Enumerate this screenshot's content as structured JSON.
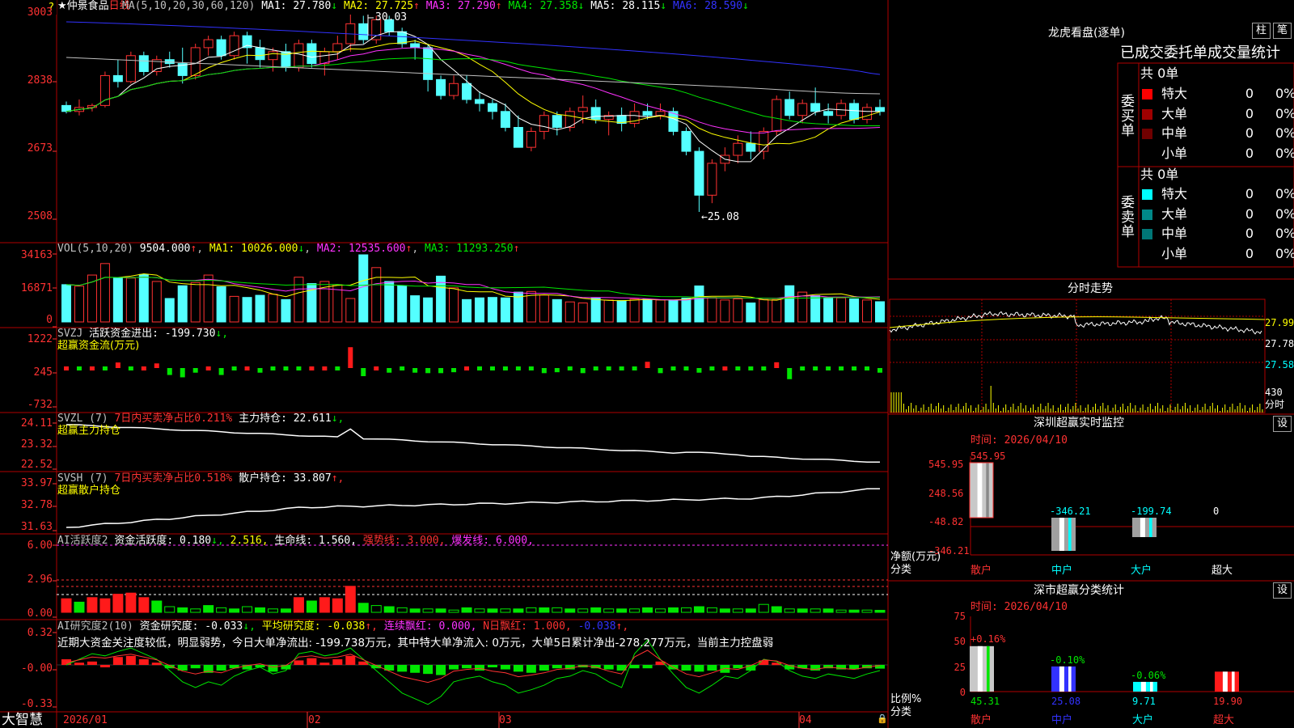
{
  "stock": {
    "star": "★",
    "name": "仲景食品",
    "period": "日线"
  },
  "main": {
    "ma_title": "MA(5,10,20,30,60,120)",
    "ma1": "MA1: 27.780",
    "ma2": "MA2: 27.725",
    "ma3": "MA3: 27.290",
    "ma4": "MA4: 27.358",
    "ma5": "MA5: 28.115",
    "ma6": "MA6: 28.590",
    "ma1_dir": "↓",
    "ma2_dir": "↑",
    "ma3_dir": "↑",
    "ma4_dir": "↓",
    "ma5_dir": "↓",
    "ma6_dir": "↓",
    "yticks": [
      "3003",
      "2838",
      "2673",
      "2508"
    ],
    "high_label": "30.03",
    "low_label": "←25.08"
  },
  "vol": {
    "title": "VOL(5,10,20)",
    "value": "9504.000",
    "value_dir": "↑",
    "ma1": "MA1: 10026.000",
    "ma1_dir": "↓",
    "ma2": "MA2: 12535.600",
    "ma2_dir": "↑",
    "ma3": "MA3: 11293.250",
    "ma3_dir": "↑",
    "yticks": [
      "34163",
      "16871",
      "0"
    ]
  },
  "svzj": {
    "title": "SVZJ",
    "label": "活跃资金进出: -199.730",
    "dir": "↓,",
    "sub": "超赢资金流(万元)",
    "yticks": [
      "1222",
      "245",
      "-732"
    ]
  },
  "svzl": {
    "title": "SVZL (7)",
    "label1": "7日内买卖净占比0.211%",
    "label2": "主力持仓: 22.611",
    "dir": "↓,",
    "sub": "超赢主力持仓",
    "yticks": [
      "24.11",
      "23.32",
      "22.52"
    ]
  },
  "svsh": {
    "title": "SVSH (7)",
    "label1": "7日内买卖净占比0.518%",
    "label2": "散户持仓: 33.807",
    "dir": "↑,",
    "sub": "超赢散户持仓",
    "yticks": [
      "33.97",
      "32.78",
      "31.63"
    ]
  },
  "ai1": {
    "title": "AI活跃度2",
    "label": "资金活跃度: 0.180",
    "dir": "↓,",
    "v2": "2.516,",
    "life": "生命线: 1.560,",
    "strong": "强势线: 3.000,",
    "burst": "爆发线: 6.000,",
    "yticks": [
      "6.00",
      "2.96",
      "0.00"
    ]
  },
  "ai2": {
    "title": "AI研究度2(10)",
    "label": "资金研究度: -0.033",
    "dir": "↓,",
    "avg": "平均研究度: -0.038",
    "avg_dir": "↑,",
    "cont": "连续飘红: 0.000,",
    "nday": "N日飘红: 1.000,",
    "neg": "-0.038",
    "neg_dir": "↑,",
    "comment": "近期大资金关注度较低，明显弱势，今日大单净流出: -199.738万元，其中特大单净流入: 0万元，大单5日累计净出-278.277万元，当前主力控盘弱",
    "yticks": [
      "0.32",
      "-0.00",
      "-0.33"
    ]
  },
  "xaxis": {
    "labels": [
      "2026/01",
      "02",
      "03",
      "04"
    ]
  },
  "footer": {
    "brand": "大智慧"
  },
  "right": {
    "lhb_title": "龙虎看盘(逐单)",
    "btn_zhu": "柱",
    "btn_bi": "笔",
    "stats_title": "已成交委托单成交量统计",
    "buy": {
      "side": "委买单",
      "total": "共 0单",
      "rows": [
        {
          "name": "特大",
          "count": "0",
          "pct": "0%"
        },
        {
          "name": "大单",
          "count": "0",
          "pct": "0%"
        },
        {
          "name": "中单",
          "count": "0",
          "pct": "0%"
        },
        {
          "name": "小单",
          "count": "0",
          "pct": "0%"
        }
      ]
    },
    "sell": {
      "side": "委卖单",
      "total": "共 0单",
      "rows": [
        {
          "name": "特大",
          "count": "0",
          "pct": "0%"
        },
        {
          "name": "大单",
          "count": "0",
          "pct": "0%"
        },
        {
          "name": "中单",
          "count": "0",
          "pct": "0%"
        },
        {
          "name": "小单",
          "count": "0",
          "pct": "0%"
        }
      ]
    },
    "fs_title": "分时走势",
    "fs_prices": [
      "27.99",
      "27.78",
      "27.58"
    ],
    "fs_vol": "430",
    "fs_unit": "分时",
    "monitor": {
      "title": "深圳超赢实时监控",
      "btn": "设",
      "time": "时间: 2026/04/10",
      "yticks": [
        "545.95",
        "248.56",
        "-48.82",
        "-346.21"
      ],
      "ylabel": "净额(万元)",
      "xlabel": "分类",
      "categories": [
        "散户",
        "中户",
        "大户",
        "超大"
      ],
      "values_text": [
        "545.95",
        "-346.21",
        "-199.74",
        "0"
      ]
    },
    "dist": {
      "title": "深市超赢分类统计",
      "btn": "设",
      "time": "时间: 2026/04/10",
      "yticks": [
        "75",
        "50",
        "25",
        "0"
      ],
      "ylabel": "比例%",
      "xlabel": "分类",
      "categories": [
        "散户",
        "中户",
        "大户",
        "超大"
      ],
      "pct_change": [
        "+0.16%",
        "-0.10%",
        "-0.06%",
        ""
      ],
      "values_text": [
        "45.31",
        "25.08",
        "9.71",
        "19.90"
      ]
    }
  },
  "chart_data": [
    {
      "type": "candlestick",
      "title": "仲景食品 日线",
      "ylim": [
        25.08,
        30.03
      ],
      "ma": {
        "MA1": 27.78,
        "MA2": 27.725,
        "MA3": 27.29,
        "MA4": 27.358,
        "MA5": 28.115,
        "MA6": 28.59
      },
      "ohlc": [
        [
          27.75,
          27.85,
          27.55,
          27.6
        ],
        [
          27.6,
          27.9,
          27.5,
          27.7
        ],
        [
          27.7,
          27.8,
          27.6,
          27.75
        ],
        [
          27.75,
          28.6,
          27.7,
          28.5
        ],
        [
          28.5,
          28.9,
          28.2,
          28.35
        ],
        [
          28.35,
          29.1,
          28.3,
          29.0
        ],
        [
          29.0,
          29.1,
          28.5,
          28.6
        ],
        [
          28.6,
          29.0,
          28.5,
          28.9
        ],
        [
          28.9,
          29.1,
          28.7,
          28.8
        ],
        [
          28.8,
          29.2,
          28.3,
          28.5
        ],
        [
          28.5,
          29.3,
          28.4,
          29.2
        ],
        [
          29.2,
          29.5,
          29.0,
          29.4
        ],
        [
          29.4,
          29.5,
          28.9,
          29.0
        ],
        [
          29.0,
          29.6,
          28.9,
          29.5
        ],
        [
          29.5,
          29.6,
          28.8,
          29.2
        ],
        [
          29.2,
          29.4,
          28.7,
          28.9
        ],
        [
          28.9,
          29.2,
          28.6,
          29.1
        ],
        [
          29.1,
          29.3,
          28.6,
          28.7
        ],
        [
          28.7,
          29.4,
          28.6,
          29.3
        ],
        [
          29.3,
          29.4,
          28.7,
          28.8
        ],
        [
          28.8,
          29.2,
          28.5,
          29.1
        ],
        [
          29.1,
          29.5,
          28.9,
          29.3
        ],
        [
          29.3,
          30.03,
          29.1,
          29.8
        ],
        [
          29.8,
          30.0,
          29.3,
          29.4
        ],
        [
          29.4,
          30.0,
          29.3,
          29.9
        ],
        [
          29.9,
          30.0,
          29.5,
          29.6
        ],
        [
          29.6,
          29.7,
          29.2,
          29.3
        ],
        [
          29.3,
          29.4,
          28.9,
          29.2
        ],
        [
          29.2,
          29.3,
          28.1,
          28.4
        ],
        [
          28.4,
          28.5,
          27.9,
          28.0
        ],
        [
          28.0,
          28.5,
          27.9,
          28.3
        ],
        [
          28.3,
          28.5,
          27.8,
          27.9
        ],
        [
          27.9,
          28.1,
          27.6,
          27.8
        ],
        [
          27.8,
          27.9,
          27.4,
          27.6
        ],
        [
          27.6,
          27.8,
          27.1,
          27.2
        ],
        [
          27.2,
          27.5,
          26.7,
          26.7
        ],
        [
          26.7,
          27.2,
          26.6,
          27.1
        ],
        [
          27.1,
          27.6,
          26.9,
          27.5
        ],
        [
          27.5,
          27.6,
          27.0,
          27.2
        ],
        [
          27.2,
          27.7,
          27.1,
          27.6
        ],
        [
          27.6,
          28.0,
          27.3,
          27.7
        ],
        [
          27.7,
          27.9,
          27.3,
          27.4
        ],
        [
          27.4,
          27.6,
          27.0,
          27.5
        ],
        [
          27.5,
          27.7,
          27.1,
          27.3
        ],
        [
          27.3,
          27.8,
          27.2,
          27.6
        ],
        [
          27.6,
          27.8,
          27.4,
          27.5
        ],
        [
          27.5,
          27.8,
          27.4,
          27.6
        ],
        [
          27.6,
          27.7,
          27.0,
          27.1
        ],
        [
          27.1,
          27.2,
          26.5,
          26.6
        ],
        [
          26.6,
          26.7,
          25.08,
          25.5
        ],
        [
          25.5,
          26.4,
          25.3,
          26.3
        ],
        [
          26.3,
          26.7,
          26.1,
          26.5
        ],
        [
          26.5,
          27.0,
          26.3,
          26.8
        ],
        [
          26.8,
          27.1,
          26.4,
          26.6
        ],
        [
          26.6,
          27.2,
          26.4,
          27.1
        ],
        [
          27.1,
          28.0,
          27.0,
          27.9
        ],
        [
          27.9,
          28.1,
          27.4,
          27.5
        ],
        [
          27.5,
          27.9,
          27.3,
          27.8
        ],
        [
          27.8,
          28.2,
          27.5,
          27.6
        ],
        [
          27.6,
          27.8,
          27.3,
          27.5
        ],
        [
          27.5,
          27.9,
          27.4,
          27.8
        ],
        [
          27.8,
          27.9,
          27.3,
          27.4
        ],
        [
          27.4,
          27.8,
          27.3,
          27.7
        ],
        [
          27.7,
          27.9,
          27.5,
          27.6
        ]
      ]
    },
    {
      "type": "bar",
      "title": "VOL(5,10,20)",
      "ylim": [
        0,
        34163
      ],
      "last": 9504,
      "ma": {
        "MA1": 10026,
        "MA2": 12535.6,
        "MA3": 11293.25
      },
      "values": [
        17500,
        16800,
        22000,
        27400,
        20600,
        20600,
        22300,
        19000,
        11000,
        17000,
        18500,
        22000,
        16500,
        12000,
        11500,
        12500,
        13000,
        10500,
        21000,
        18000,
        19000,
        17500,
        11000,
        31500,
        25500,
        19000,
        17000,
        12300,
        11300,
        21500,
        16000,
        10500,
        11300,
        11500,
        11300,
        14000,
        14300,
        12600,
        10500,
        9400,
        8900,
        11300,
        10300,
        10000,
        10700,
        10600,
        10300,
        10300,
        11200,
        16900,
        11500,
        10300,
        10800,
        8900,
        10500,
        10500,
        17000,
        14000,
        12300,
        11300,
        11300,
        10800,
        10300,
        9500
      ]
    },
    {
      "type": "bar",
      "title": "超赢资金流(万元)",
      "ylim": [
        -732,
        1222
      ],
      "last": -199.73,
      "values": [
        50,
        -50,
        20,
        -60,
        240,
        -80,
        60,
        200,
        -300,
        -400,
        -200,
        100,
        -300,
        -100,
        60,
        -200,
        -100,
        -80,
        -150,
        100,
        80,
        -100,
        900,
        -350,
        80,
        -200,
        -150,
        -200,
        -220,
        -220,
        -180,
        100,
        -70,
        -70,
        -50,
        -80,
        -130,
        -220,
        -180,
        -130,
        -220,
        -140,
        -120,
        -120,
        -150,
        270,
        -220,
        -70,
        -140,
        -200,
        -80,
        110,
        -60,
        -120,
        -80,
        250,
        -480,
        -50,
        -120,
        -120,
        -130,
        -80,
        -100,
        -200
      ]
    },
    {
      "type": "line",
      "title": "超赢主力持仓",
      "ylim": [
        22.52,
        24.11
      ],
      "last": 22.611
    },
    {
      "type": "line",
      "title": "超赢散户持仓",
      "ylim": [
        31.63,
        33.97
      ],
      "last": 33.807
    },
    {
      "type": "bar",
      "title": "AI活跃度2",
      "ylim": [
        0,
        6
      ],
      "lines": {
        "生命线": 1.56,
        "强势线": 3.0,
        "爆发线": 6.0
      },
      "last": 0.18
    },
    {
      "type": "bar",
      "title": "AI研究度2(10)",
      "ylim": [
        -0.33,
        0.32
      ],
      "last": -0.033,
      "avg": -0.038
    },
    {
      "type": "bar",
      "title": "深圳超赢实时监控",
      "categories": [
        "散户",
        "中户",
        "大户",
        "超大"
      ],
      "values": [
        545.95,
        -346.21,
        -199.74,
        0
      ],
      "ylim": [
        -346.21,
        545.95
      ]
    },
    {
      "type": "bar",
      "title": "深市超赢分类统计",
      "categories": [
        "散户",
        "中户",
        "大户",
        "超大"
      ],
      "values": [
        45.31,
        25.08,
        9.71,
        19.9
      ],
      "ylim": [
        0,
        75
      ]
    }
  ]
}
